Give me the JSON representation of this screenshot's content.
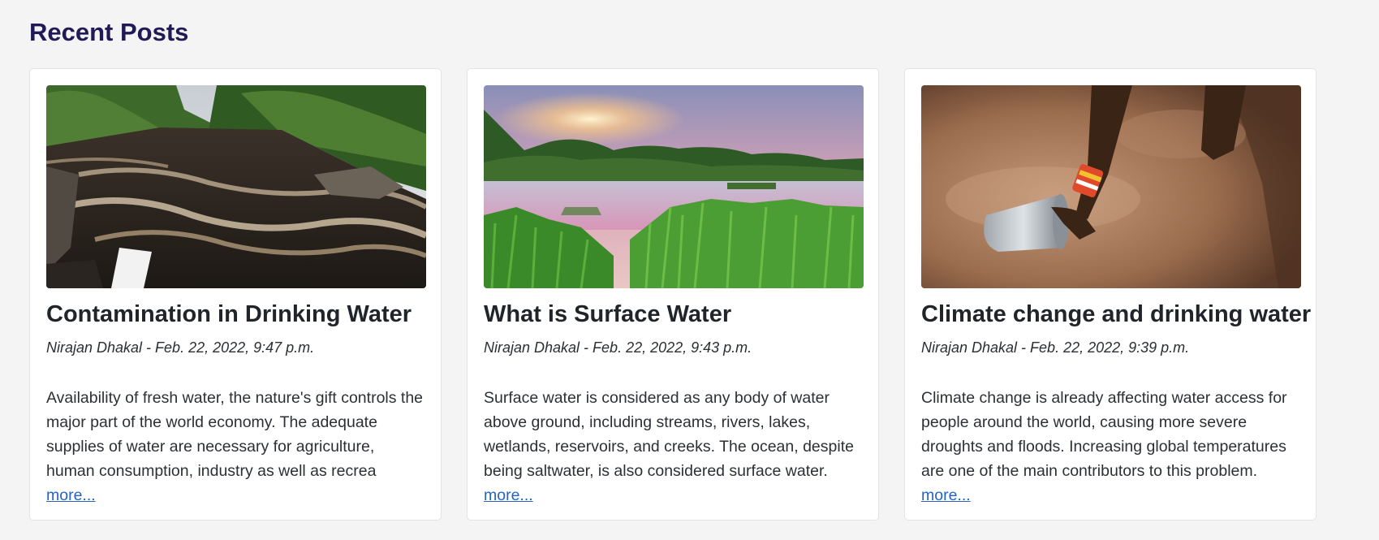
{
  "section": {
    "title": "Recent Posts"
  },
  "posts": [
    {
      "title": "Contamination in Drinking Water",
      "meta": "Nirajan Dhakal - Feb. 22, 2022, 9:47 p.m.",
      "excerpt": "Availability of fresh water, the nature's gift controls the major part of the world economy. The adequate supplies of water are necessary for agriculture, human consumption, industry as well as recrea",
      "more_label": "more...",
      "image": "river-rapids-image"
    },
    {
      "title": "What is Surface Water",
      "meta": "Nirajan Dhakal - Feb. 22, 2022, 9:43 p.m.",
      "excerpt": "Surface water is considered as any body of water above ground, including streams, rivers, lakes, wetlands, reservoirs, and creeks. The ocean, despite being saltwater, is also considered surface water.",
      "more_label": "more...",
      "image": "sunset-lake-image"
    },
    {
      "title": "Climate change and drinking water",
      "meta": "Nirajan Dhakal - Feb. 22, 2022, 9:39 p.m.",
      "excerpt": "Climate change is already affecting water access for people around the world, causing more severe droughts and floods. Increasing global temperatures are one of the main contributors to this problem.",
      "more_label": "more...",
      "image": "muddy-water-image"
    }
  ],
  "colors": {
    "page_background": "#f4f4f5",
    "heading": "#221a57",
    "link": "#2563c7",
    "card_border": "#e1e3e6"
  }
}
